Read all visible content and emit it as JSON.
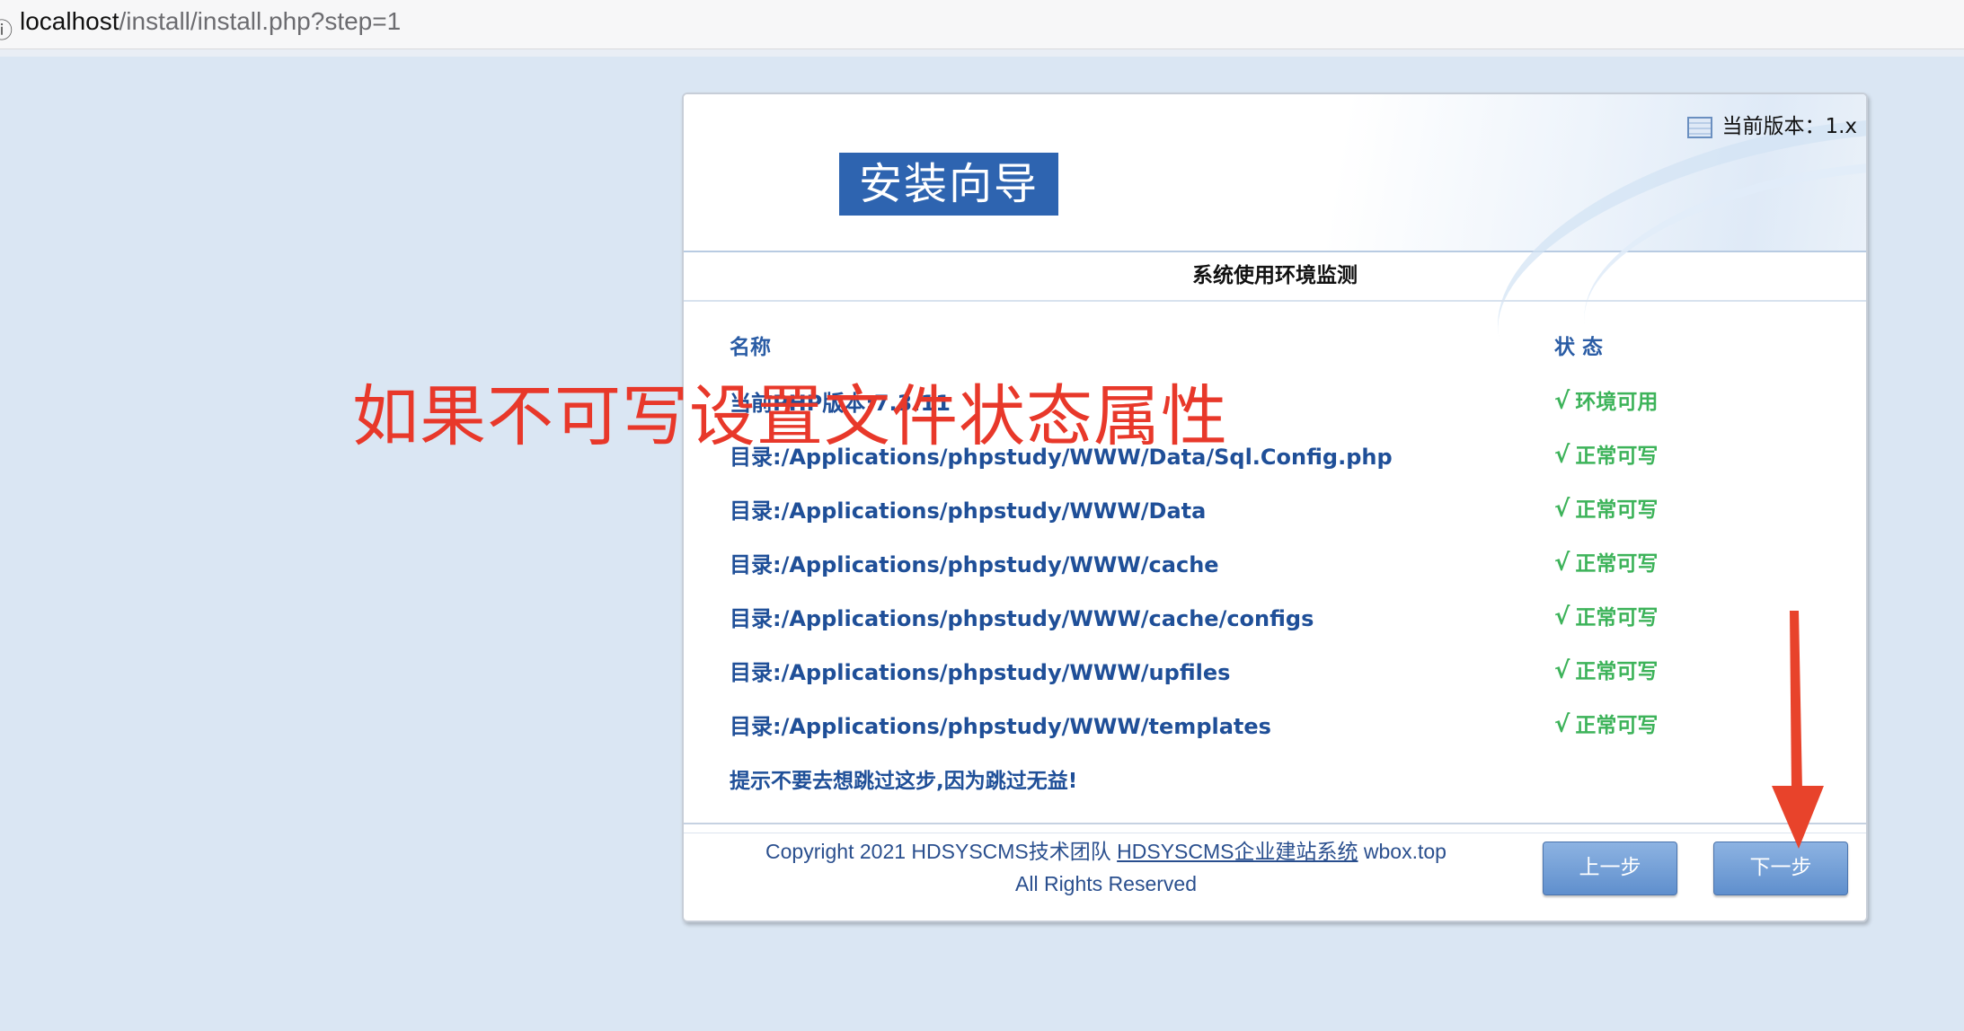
{
  "browser": {
    "url_host": "localhost",
    "url_path": "/install/install.php?step=1"
  },
  "header": {
    "logo_text": "安装向导",
    "version_label": "当前版本：1.x"
  },
  "section_title": "系统使用环境监测",
  "columns": {
    "name": "名称",
    "status": "状 态"
  },
  "rows": [
    {
      "name": "当前PHP版本:7.3.11",
      "status": "环境可用"
    },
    {
      "name": "目录:/Applications/phpstudy/WWW/Data/Sql.Config.php",
      "status": "正常可写"
    },
    {
      "name": "目录:/Applications/phpstudy/WWW/Data",
      "status": "正常可写"
    },
    {
      "name": "目录:/Applications/phpstudy/WWW/cache",
      "status": "正常可写"
    },
    {
      "name": "目录:/Applications/phpstudy/WWW/cache/configs",
      "status": "正常可写"
    },
    {
      "name": "目录:/Applications/phpstudy/WWW/upfiles",
      "status": "正常可写"
    },
    {
      "name": "目录:/Applications/phpstudy/WWW/templates",
      "status": "正常可写"
    }
  ],
  "check_mark": "√",
  "tip": "提示不要去想跳过这步,因为跳过无益!",
  "footer": {
    "copyright_prefix": "Copyright 2021 HDSYSCMS技术团队 ",
    "copyright_link": "HDSYSCMS企业建站系统",
    "copyright_suffix": " wbox.top",
    "rights": "All Rights Reserved"
  },
  "buttons": {
    "prev": "上一步",
    "next": "下一步"
  },
  "annotation": {
    "text": "如果不可写设置文件状态属性",
    "color": "#e8382a"
  }
}
